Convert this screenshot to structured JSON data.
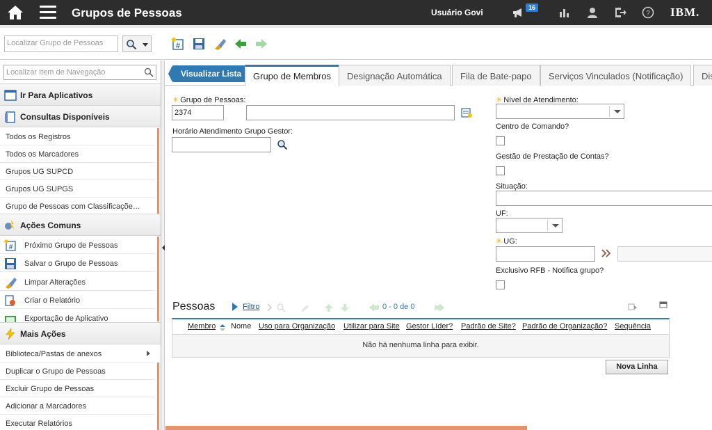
{
  "header": {
    "title": "Grupos de Pessoas",
    "user": "Usuário Govi",
    "notification_count": "16",
    "brand": "IBM."
  },
  "toolbar": {
    "search_placeholder": "Localizar Grupo de Pessoas"
  },
  "sidebar": {
    "search_placeholder": "Localizar Item de Navegação",
    "sections": {
      "goto": "Ir Para Aplicativos",
      "queries": "Consultas Disponíveis",
      "common": "Ações Comuns",
      "more": "Mais Ações"
    },
    "queries": [
      "Todos os Registros",
      "Todos os Marcadores",
      "Grupos UG SUPCD",
      "Grupos UG SUPGS",
      "Grupo de Pessoas com Classificaçõe…"
    ],
    "common": [
      "Próximo Grupo de Pessoas",
      "Salvar o Grupo de Pessoas",
      "Limpar Alterações",
      "Criar o Relatório",
      "Exportação de Aplicativo"
    ],
    "more": [
      "Biblioteca/Pastas de anexos",
      "Duplicar o Grupo de Pessoas",
      "Excluir Grupo de Pessoas",
      "Adicionar a Marcadores",
      "Executar Relatórios"
    ]
  },
  "tabs": {
    "list_button": "Visualizar Lista",
    "items": [
      "Grupo de Membros",
      "Designação Automática",
      "Fila de Bate-papo",
      "Serviços Vinculados (Notificação)",
      "Dis"
    ]
  },
  "form": {
    "group_label": "Grupo de Pessoas:",
    "group_value": "2374",
    "group_desc": "",
    "schedule_label": "Horário Atendimento Grupo Gestor:",
    "schedule_value": "",
    "service_level_label": "Nível de Atendimento:",
    "command_center_label": "Centro de Comando?",
    "accountability_label": "Gestão de Prestação de Contas?",
    "status_label": "Situação:",
    "uf_label": "UF:",
    "ug_label": "UG:",
    "rfb_label": "Exclusivo RFB - Notifica grupo?"
  },
  "table": {
    "title": "Pessoas",
    "filter": "Filtro",
    "pager": "0 - 0 de 0",
    "columns": [
      "Membro",
      "Nome",
      "Uso para Organização",
      "Utilizar para Site",
      "Gestor Líder?",
      "Padrão de Site?",
      "Padrão de Organização?",
      "Sequência"
    ],
    "empty": "Não há nenhuma linha para exibir.",
    "new_row": "Nova Linha"
  }
}
